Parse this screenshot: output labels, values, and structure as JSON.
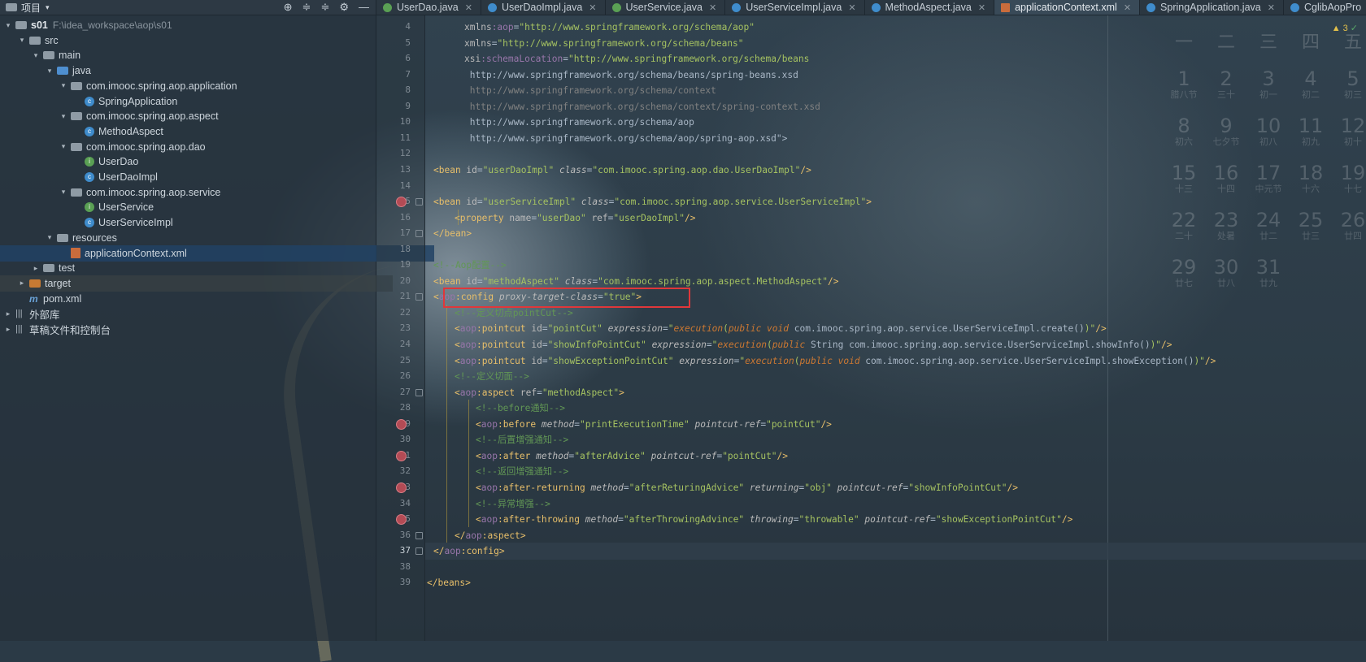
{
  "project_panel": {
    "title": "项目",
    "tools": [
      "⊕",
      "≑",
      "≑",
      "⚙",
      "—"
    ],
    "tree": [
      {
        "depth": 0,
        "arrow": "▾",
        "icon": "folder",
        "label": "s01",
        "bold": true,
        "path": "F:\\idea_workspace\\aop\\s01"
      },
      {
        "depth": 1,
        "arrow": "▾",
        "icon": "folder",
        "label": "src"
      },
      {
        "depth": 2,
        "arrow": "▾",
        "icon": "folder",
        "label": "main"
      },
      {
        "depth": 3,
        "arrow": "▾",
        "icon": "folder-blue",
        "label": "java"
      },
      {
        "depth": 4,
        "arrow": "▾",
        "icon": "package",
        "label": "com.imooc.spring.aop.application"
      },
      {
        "depth": 5,
        "arrow": "",
        "icon": "class",
        "label": "SpringApplication"
      },
      {
        "depth": 4,
        "arrow": "▾",
        "icon": "package",
        "label": "com.imooc.spring.aop.aspect"
      },
      {
        "depth": 5,
        "arrow": "",
        "icon": "class",
        "label": "MethodAspect"
      },
      {
        "depth": 4,
        "arrow": "▾",
        "icon": "package",
        "label": "com.imooc.spring.aop.dao"
      },
      {
        "depth": 5,
        "arrow": "",
        "icon": "interface",
        "label": "UserDao"
      },
      {
        "depth": 5,
        "arrow": "",
        "icon": "class",
        "label": "UserDaoImpl"
      },
      {
        "depth": 4,
        "arrow": "▾",
        "icon": "package",
        "label": "com.imooc.spring.aop.service"
      },
      {
        "depth": 5,
        "arrow": "",
        "icon": "interface",
        "label": "UserService"
      },
      {
        "depth": 5,
        "arrow": "",
        "icon": "class",
        "label": "UserServiceImpl"
      },
      {
        "depth": 3,
        "arrow": "▾",
        "icon": "folder-res",
        "label": "resources"
      },
      {
        "depth": 4,
        "arrow": "",
        "icon": "xml",
        "label": "applicationContext.xml",
        "selected": true
      },
      {
        "depth": 2,
        "arrow": "▸",
        "icon": "folder",
        "label": "test"
      },
      {
        "depth": 1,
        "arrow": "▸",
        "icon": "folder-orange",
        "label": "target",
        "target": true
      },
      {
        "depth": 1,
        "arrow": "",
        "icon": "maven",
        "label": "pom.xml"
      },
      {
        "depth": 0,
        "arrow": "▸",
        "icon": "library",
        "label": "外部库"
      },
      {
        "depth": 0,
        "arrow": "▸",
        "icon": "library",
        "label": "草稿文件和控制台"
      }
    ]
  },
  "tabs": [
    {
      "label": "UserDao.java",
      "icon": "i"
    },
    {
      "label": "UserDaoImpl.java",
      "icon": "c"
    },
    {
      "label": "UserService.java",
      "icon": "i"
    },
    {
      "label": "UserServiceImpl.java",
      "icon": "c"
    },
    {
      "label": "MethodAspect.java",
      "icon": "c"
    },
    {
      "label": "applicationContext.xml",
      "icon": "x",
      "active": true
    },
    {
      "label": "SpringApplication.java",
      "icon": "c"
    },
    {
      "label": "CglibAopPro",
      "icon": "c"
    }
  ],
  "editor": {
    "inspection": {
      "warnings": "▲ 3",
      "ok": "✓"
    },
    "current_line": 37,
    "lines": [
      {
        "n": 4,
        "ind": 3,
        "seg": [
          [
            "a",
            "xmlns"
          ],
          [
            "ns",
            ":aop"
          ],
          [
            "p",
            "="
          ],
          [
            "s",
            "\"http://www.springframework.org/schema/aop\""
          ]
        ]
      },
      {
        "n": 5,
        "ind": 3,
        "seg": [
          [
            "a",
            "xmlns"
          ],
          [
            "p",
            "="
          ],
          [
            "s",
            "\"http://www.springframework.org/schema/beans\""
          ]
        ]
      },
      {
        "n": 6,
        "ind": 3,
        "seg": [
          [
            "a",
            "xsi"
          ],
          [
            "ns",
            ":schemaLocation"
          ],
          [
            "p",
            "="
          ],
          [
            "s",
            "\"http://www.springframework.org/schema/beans"
          ]
        ]
      },
      {
        "n": 7,
        "ind": 3,
        "seg": [
          [
            "u",
            " http://www.springframework.org/schema/beans/spring-beans.xsd"
          ]
        ]
      },
      {
        "n": 8,
        "ind": 3,
        "seg": [
          [
            "g",
            " http://www.springframework.org/schema/context"
          ]
        ]
      },
      {
        "n": 9,
        "ind": 3,
        "seg": [
          [
            "g",
            " http://www.springframework.org/schema/context/spring-context.xsd"
          ]
        ]
      },
      {
        "n": 10,
        "ind": 3,
        "seg": [
          [
            "u",
            " http://www.springframework.org/schema/aop"
          ]
        ]
      },
      {
        "n": 11,
        "ind": 3,
        "seg": [
          [
            "u",
            " http://www.springframework.org/schema/aop/spring-aop.xsd\">"
          ]
        ]
      },
      {
        "n": 12,
        "ind": 0,
        "seg": []
      },
      {
        "n": 13,
        "ind": 1,
        "seg": [
          [
            "t",
            "<bean "
          ],
          [
            "a",
            "id"
          ],
          [
            "p",
            "="
          ],
          [
            "s",
            "\"userDaoImpl\""
          ],
          [
            "p",
            " "
          ],
          [
            "ai",
            "class"
          ],
          [
            "p",
            "="
          ],
          [
            "s",
            "\"com.imooc.spring.aop.dao.UserDaoImpl\""
          ],
          [
            "t",
            "/>"
          ]
        ]
      },
      {
        "n": 14,
        "ind": 0,
        "seg": []
      },
      {
        "n": 15,
        "ind": 1,
        "seg": [
          [
            "t",
            "<bean "
          ],
          [
            "a",
            "id"
          ],
          [
            "p",
            "="
          ],
          [
            "s",
            "\"userServiceImpl\""
          ],
          [
            "p",
            " "
          ],
          [
            "ai",
            "class"
          ],
          [
            "p",
            "="
          ],
          [
            "s",
            "\"com.imooc.spring.aop.service.UserServiceImpl\""
          ],
          [
            "t",
            ">"
          ]
        ]
      },
      {
        "n": 16,
        "ind": 2,
        "seg": [
          [
            "t",
            "<property "
          ],
          [
            "a",
            "name"
          ],
          [
            "p",
            "="
          ],
          [
            "s",
            "\"userDao\""
          ],
          [
            "p",
            " "
          ],
          [
            "a",
            "ref"
          ],
          [
            "p",
            "="
          ],
          [
            "s",
            "\"userDaoImpl\""
          ],
          [
            "t",
            "/>"
          ]
        ]
      },
      {
        "n": 17,
        "ind": 1,
        "seg": [
          [
            "t",
            "</bean>"
          ]
        ]
      },
      {
        "n": 18,
        "ind": 0,
        "seg": []
      },
      {
        "n": 19,
        "ind": 1,
        "seg": [
          [
            "c",
            "<!--Aop配置-->"
          ]
        ]
      },
      {
        "n": 20,
        "ind": 1,
        "seg": [
          [
            "t",
            "<bean "
          ],
          [
            "a",
            "id"
          ],
          [
            "p",
            "="
          ],
          [
            "s",
            "\"methodAspect\""
          ],
          [
            "p",
            " "
          ],
          [
            "ai",
            "class"
          ],
          [
            "p",
            "="
          ],
          [
            "s",
            "\"com.imooc.spring.aop.aspect.MethodAspect\""
          ],
          [
            "t",
            "/>"
          ]
        ]
      },
      {
        "n": 21,
        "ind": 1,
        "seg": [
          [
            "t",
            "<"
          ],
          [
            "ns",
            "aop"
          ],
          [
            "t",
            ":config "
          ],
          [
            "ai",
            "proxy-target-class"
          ],
          [
            "p",
            "="
          ],
          [
            "s",
            "\"true\""
          ],
          [
            "t",
            ">"
          ]
        ]
      },
      {
        "n": 22,
        "ind": 2,
        "seg": [
          [
            "c",
            "<!--定义切点pointCut-->"
          ]
        ]
      },
      {
        "n": 23,
        "ind": 2,
        "seg": [
          [
            "t",
            "<"
          ],
          [
            "ns",
            "aop"
          ],
          [
            "t",
            ":pointcut "
          ],
          [
            "a",
            "id"
          ],
          [
            "p",
            "="
          ],
          [
            "s",
            "\"pointCut\""
          ],
          [
            "p",
            " "
          ],
          [
            "ai",
            "expression"
          ],
          [
            "p",
            "="
          ],
          [
            "s",
            "\""
          ],
          [
            "k",
            "execution"
          ],
          [
            "s",
            "("
          ],
          [
            "k",
            "public void"
          ],
          [
            "p",
            " com.imooc.spring.aop.service.UserServiceImpl.create()"
          ],
          [
            "s",
            ")\""
          ],
          [
            "t",
            "/>"
          ]
        ]
      },
      {
        "n": 24,
        "ind": 2,
        "seg": [
          [
            "t",
            "<"
          ],
          [
            "ns",
            "aop"
          ],
          [
            "t",
            ":pointcut "
          ],
          [
            "a",
            "id"
          ],
          [
            "p",
            "="
          ],
          [
            "s",
            "\"showInfoPointCut\""
          ],
          [
            "p",
            " "
          ],
          [
            "ai",
            "expression"
          ],
          [
            "p",
            "="
          ],
          [
            "s",
            "\""
          ],
          [
            "k",
            "execution"
          ],
          [
            "s",
            "("
          ],
          [
            "k",
            "public"
          ],
          [
            "p",
            " String com.imooc.spring.aop.service.UserServiceImpl.showInfo()"
          ],
          [
            "s",
            ")\""
          ],
          [
            "t",
            "/>"
          ]
        ]
      },
      {
        "n": 25,
        "ind": 2,
        "seg": [
          [
            "t",
            "<"
          ],
          [
            "ns",
            "aop"
          ],
          [
            "t",
            ":pointcut "
          ],
          [
            "a",
            "id"
          ],
          [
            "p",
            "="
          ],
          [
            "s",
            "\"showExceptionPointCut\""
          ],
          [
            "p",
            " "
          ],
          [
            "ai",
            "expression"
          ],
          [
            "p",
            "="
          ],
          [
            "s",
            "\""
          ],
          [
            "k",
            "execution"
          ],
          [
            "s",
            "("
          ],
          [
            "k",
            "public void"
          ],
          [
            "p",
            " com.imooc.spring.aop.service.UserServiceImpl.showException()"
          ],
          [
            "s",
            ")\""
          ],
          [
            "t",
            "/>"
          ]
        ]
      },
      {
        "n": 26,
        "ind": 2,
        "seg": [
          [
            "c",
            "<!--定义切面-->"
          ]
        ]
      },
      {
        "n": 27,
        "ind": 2,
        "seg": [
          [
            "t",
            "<"
          ],
          [
            "ns",
            "aop"
          ],
          [
            "t",
            ":aspect "
          ],
          [
            "a",
            "ref"
          ],
          [
            "p",
            "="
          ],
          [
            "s",
            "\"methodAspect\""
          ],
          [
            "t",
            ">"
          ]
        ]
      },
      {
        "n": 28,
        "ind": 3,
        "seg": [
          [
            "c",
            "<!--before通知-->"
          ]
        ]
      },
      {
        "n": 29,
        "ind": 3,
        "seg": [
          [
            "t",
            "<"
          ],
          [
            "ns",
            "aop"
          ],
          [
            "t",
            ":before "
          ],
          [
            "ai",
            "method"
          ],
          [
            "p",
            "="
          ],
          [
            "s",
            "\"printExecutionTime\""
          ],
          [
            "p",
            " "
          ],
          [
            "ai",
            "pointcut-ref"
          ],
          [
            "p",
            "="
          ],
          [
            "s",
            "\"pointCut\""
          ],
          [
            "t",
            "/>"
          ]
        ]
      },
      {
        "n": 30,
        "ind": 3,
        "seg": [
          [
            "c",
            "<!--后置增强通知-->"
          ]
        ]
      },
      {
        "n": 31,
        "ind": 3,
        "seg": [
          [
            "t",
            "<"
          ],
          [
            "ns",
            "aop"
          ],
          [
            "t",
            ":after "
          ],
          [
            "ai",
            "method"
          ],
          [
            "p",
            "="
          ],
          [
            "s",
            "\"afterAdvice\""
          ],
          [
            "p",
            " "
          ],
          [
            "ai",
            "pointcut-ref"
          ],
          [
            "p",
            "="
          ],
          [
            "s",
            "\"pointCut\""
          ],
          [
            "t",
            "/>"
          ]
        ]
      },
      {
        "n": 32,
        "ind": 3,
        "seg": [
          [
            "c",
            "<!--返回增强通知-->"
          ]
        ]
      },
      {
        "n": 33,
        "ind": 3,
        "seg": [
          [
            "t",
            "<"
          ],
          [
            "ns",
            "aop"
          ],
          [
            "t",
            ":after-returning "
          ],
          [
            "ai",
            "method"
          ],
          [
            "p",
            "="
          ],
          [
            "s",
            "\"afterReturingAdvice\""
          ],
          [
            "p",
            " "
          ],
          [
            "ai",
            "returning"
          ],
          [
            "p",
            "="
          ],
          [
            "s",
            "\"obj\""
          ],
          [
            "p",
            " "
          ],
          [
            "ai",
            "pointcut-ref"
          ],
          [
            "p",
            "="
          ],
          [
            "s",
            "\"showInfoPointCut\""
          ],
          [
            "t",
            "/>"
          ]
        ]
      },
      {
        "n": 34,
        "ind": 3,
        "seg": [
          [
            "c",
            "<!--异常增强-->"
          ]
        ]
      },
      {
        "n": 35,
        "ind": 3,
        "seg": [
          [
            "t",
            "<"
          ],
          [
            "ns",
            "aop"
          ],
          [
            "t",
            ":after-throwing "
          ],
          [
            "ai",
            "method"
          ],
          [
            "p",
            "="
          ],
          [
            "s",
            "\"afterThrowingAdvince\""
          ],
          [
            "p",
            " "
          ],
          [
            "ai",
            "throwing"
          ],
          [
            "p",
            "="
          ],
          [
            "s",
            "\"throwable\""
          ],
          [
            "p",
            " "
          ],
          [
            "ai",
            "pointcut-ref"
          ],
          [
            "p",
            "="
          ],
          [
            "s",
            "\"showExceptionPointCut\""
          ],
          [
            "t",
            "/>"
          ]
        ]
      },
      {
        "n": 36,
        "ind": 2,
        "seg": [
          [
            "t",
            "</"
          ],
          [
            "ns",
            "aop"
          ],
          [
            "t",
            ":aspect>"
          ]
        ]
      },
      {
        "n": 37,
        "ind": 1,
        "seg": [
          [
            "t",
            "</"
          ],
          [
            "ns",
            "aop"
          ],
          [
            "t",
            ":config>"
          ]
        ]
      },
      {
        "n": 38,
        "ind": 0,
        "seg": []
      },
      {
        "n": 39,
        "ind": 0,
        "seg": [
          [
            "t",
            "</beans>"
          ]
        ]
      }
    ]
  },
  "calendar": {
    "weekdays": [
      "一",
      "二",
      "三",
      "四",
      "五"
    ],
    "rows": [
      [
        [
          "1",
          "腊八节"
        ],
        [
          "2",
          "三十"
        ],
        [
          "3",
          "初一"
        ],
        [
          "4",
          "初二"
        ],
        [
          "5",
          "初三"
        ]
      ],
      [
        [
          "8",
          "初六"
        ],
        [
          "9",
          "七夕节"
        ],
        [
          "10",
          "初八"
        ],
        [
          "11",
          "初九"
        ],
        [
          "12",
          "初十"
        ]
      ],
      [
        [
          "15",
          "十三"
        ],
        [
          "16",
          "十四"
        ],
        [
          "17",
          "中元节"
        ],
        [
          "18",
          "十六"
        ],
        [
          "19",
          "十七"
        ]
      ],
      [
        [
          "22",
          "二十"
        ],
        [
          "23",
          "处暑"
        ],
        [
          "24",
          "廿二"
        ],
        [
          "25",
          "廿三"
        ],
        [
          "26",
          "廿四"
        ]
      ],
      [
        [
          "29",
          "廿七"
        ],
        [
          "30",
          "廿八"
        ],
        [
          "31",
          "廿九"
        ]
      ]
    ]
  }
}
